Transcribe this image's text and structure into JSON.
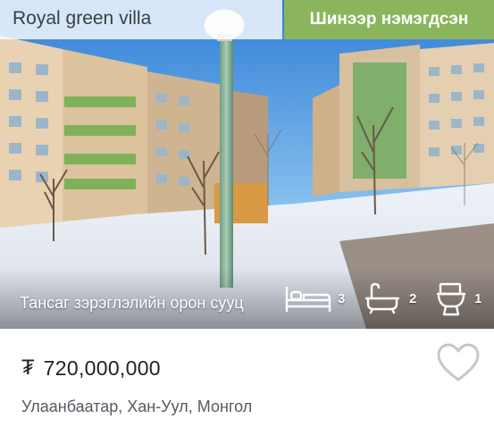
{
  "listing": {
    "project_name": "Royal green villa",
    "badge": "Шинээр нэмэгдсэн",
    "property_type": "Тансаг зэрэглэлийн орон сууц",
    "amenities": {
      "bedrooms": {
        "icon": "bed-icon",
        "count": "3"
      },
      "bathrooms": {
        "icon": "bathtub-icon",
        "count": "2"
      },
      "toilets": {
        "icon": "toilet-icon",
        "count": "1"
      }
    },
    "currency_symbol": "₮",
    "price": "720,000,000",
    "location": "Улаанбаатар, Хан-Уул, Монгол",
    "favorite_icon": "heart-outline-icon"
  },
  "colors": {
    "badge_background": "#8bb55c",
    "text_dark": "#222222",
    "text_muted": "#555b62"
  }
}
